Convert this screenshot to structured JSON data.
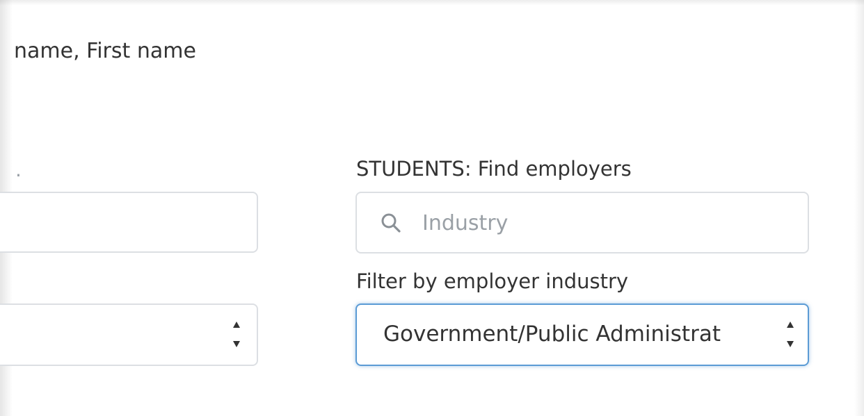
{
  "header": {
    "name_hint": "name, First name"
  },
  "left_column": {
    "label_fragment": "."
  },
  "employers": {
    "title": "STUDENTS: Find employers",
    "search": {
      "placeholder": "Industry",
      "value": "",
      "icon": "search-icon"
    },
    "filter": {
      "label": "Filter by employer industry",
      "selected": "Government/Public Administrat"
    }
  },
  "colors": {
    "focus_border": "#5b9bd5",
    "input_border": "#dcdfe3",
    "text": "#333333",
    "placeholder": "#9aa0a6"
  }
}
